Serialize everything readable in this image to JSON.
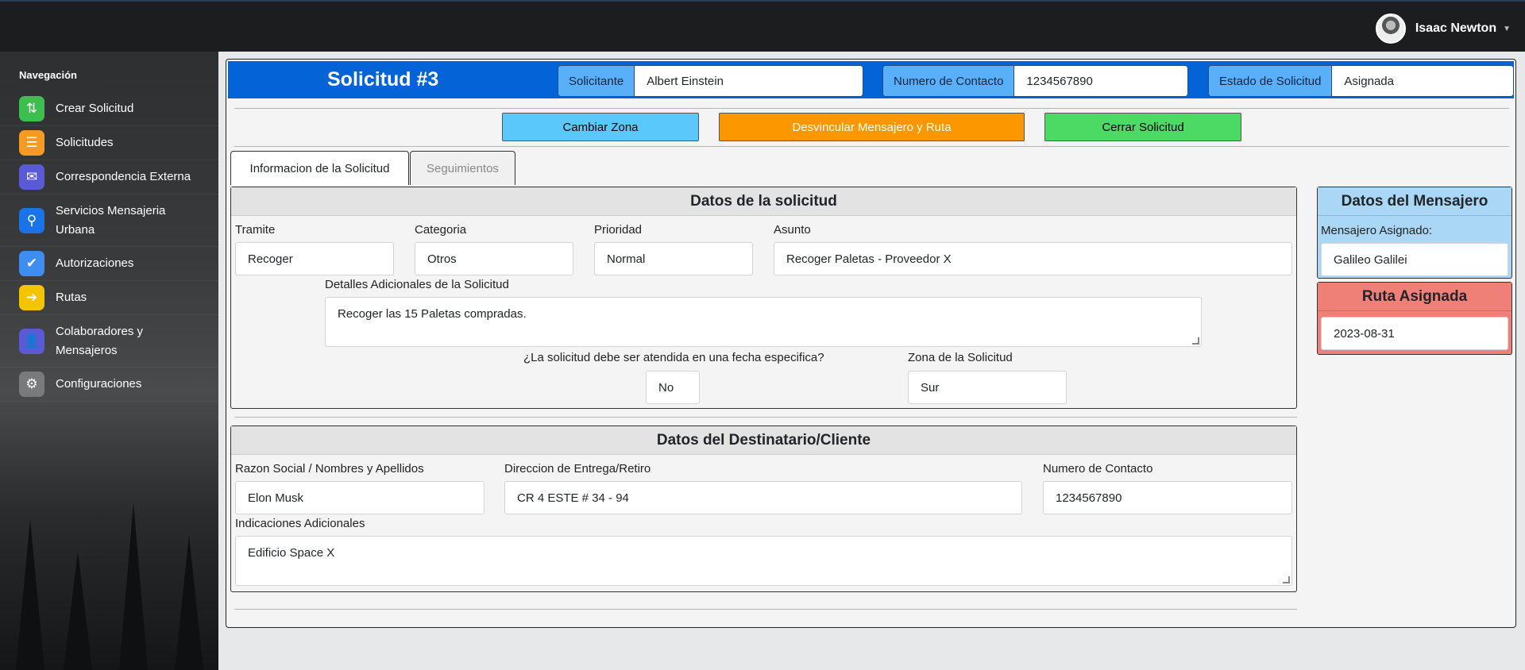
{
  "topbar": {
    "user_name": "Isaac Newton"
  },
  "sidebar": {
    "title": "Navegación",
    "items": [
      {
        "label": "Crear Solicitud",
        "icon": "git-pull-request-icon",
        "color": "#3cbf4e"
      },
      {
        "label": "Solicitudes",
        "icon": "list-icon",
        "color": "#f59a23"
      },
      {
        "label": "Correspondencia Externa",
        "icon": "envelope-icon",
        "color": "#5a5ad6"
      },
      {
        "label": "Servicios Mensajeria Urbana",
        "icon": "motorcycle-icon",
        "color": "#1a73e8"
      },
      {
        "label": "Autorizaciones",
        "icon": "clipboard-check-icon",
        "color": "#3d8ef0"
      },
      {
        "label": "Rutas",
        "icon": "route-icon",
        "color": "#f5c400"
      },
      {
        "label": "Colaboradores y Mensajeros",
        "icon": "user-shield-icon",
        "color": "#5a5ad6"
      },
      {
        "label": "Configuraciones",
        "icon": "gear-icon",
        "color": "#7a7a7a"
      }
    ]
  },
  "header": {
    "title": "Solicitud #3",
    "solicitante_label": "Solicitante",
    "solicitante_value": "Albert Einstein",
    "contacto_label": "Numero de Contacto",
    "contacto_value": "1234567890",
    "estado_label": "Estado de Solicitud",
    "estado_value": "Asignada"
  },
  "actions": {
    "cambiar_zona": "Cambiar Zona",
    "desvincular": "Desvincular Mensajero y Ruta",
    "cerrar": "Cerrar Solicitud",
    "colors": {
      "cambiar_zona": "#5bc8fb",
      "desvincular": "#fd9700",
      "cerrar": "#4cd964"
    }
  },
  "tabs": [
    {
      "label": "Informacion de la Solicitud",
      "active": true
    },
    {
      "label": "Seguimientos",
      "active": false
    }
  ],
  "solicitud": {
    "heading": "Datos de la solicitud",
    "tramite_label": "Tramite",
    "tramite_value": "Recoger",
    "categoria_label": "Categoria",
    "categoria_value": "Otros",
    "prioridad_label": "Prioridad",
    "prioridad_value": "Normal",
    "asunto_label": "Asunto",
    "asunto_value": "Recoger Paletas - Proveedor X",
    "detalles_label": "Detalles Adicionales de la Solicitud",
    "detalles_value": "Recoger las 15 Paletas compradas.",
    "fecha_label": "¿La solicitud debe ser atendida en una fecha especifica?",
    "fecha_value": "No",
    "zona_label": "Zona de la Solicitud",
    "zona_value": "Sur"
  },
  "destinatario": {
    "heading": "Datos del Destinatario/Cliente",
    "razon_label": "Razon Social / Nombres y Apellidos",
    "razon_value": "Elon Musk",
    "direccion_label": "Direccion de Entrega/Retiro",
    "direccion_value": "CR 4 ESTE # 34 - 94",
    "contacto_label": "Numero de Contacto",
    "contacto_value": "1234567890",
    "indicaciones_label": "Indicaciones Adicionales",
    "indicaciones_value": "Edificio Space X"
  },
  "mensajero": {
    "heading": "Datos del Mensajero",
    "asignado_label": "Mensajero Asignado:",
    "asignado_value": "Galileo Galilei",
    "color": "#a9d7f5"
  },
  "ruta": {
    "heading": "Ruta Asignada",
    "value": "2023-08-31",
    "color": "#ef8078"
  }
}
